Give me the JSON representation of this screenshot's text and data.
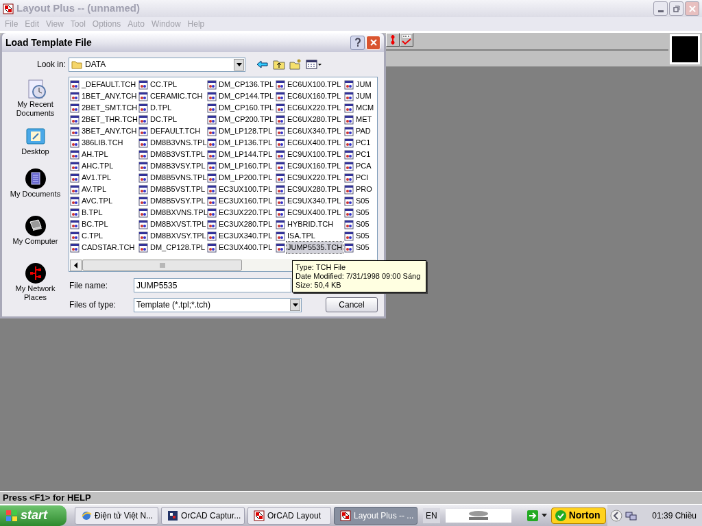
{
  "app": {
    "title": "Layout Plus -- (unnamed)",
    "active": false
  },
  "menu": [
    "File",
    "Edit",
    "View",
    "Tool",
    "Options",
    "Auto",
    "Window",
    "Help"
  ],
  "dialog": {
    "title": "Load Template File",
    "look_in_label": "Look in:",
    "look_in_value": "DATA",
    "places": [
      {
        "kind": "recent",
        "label": "My Recent Documents"
      },
      {
        "kind": "desktop",
        "label": "Desktop"
      },
      {
        "kind": "documents",
        "label": "My Documents"
      },
      {
        "kind": "computer",
        "label": "My Computer"
      },
      {
        "kind": "network",
        "label": "My Network Places"
      }
    ],
    "columns": [
      [
        {
          "name": "_DEFAULT.TCH",
          "selected": false
        },
        {
          "name": "1BET_ANY.TCH",
          "selected": false
        },
        {
          "name": "2BET_SMT.TCH",
          "selected": false
        },
        {
          "name": "2BET_THR.TCH",
          "selected": false
        },
        {
          "name": "3BET_ANY.TCH",
          "selected": false
        },
        {
          "name": "386LIB.TCH",
          "selected": false
        },
        {
          "name": "AH.TPL",
          "selected": false
        },
        {
          "name": "AHC.TPL",
          "selected": false
        },
        {
          "name": "AV1.TPL",
          "selected": false
        },
        {
          "name": "AV.TPL",
          "selected": false
        },
        {
          "name": "AVC.TPL",
          "selected": false
        },
        {
          "name": "B.TPL",
          "selected": false
        },
        {
          "name": "BC.TPL",
          "selected": false
        },
        {
          "name": "C.TPL",
          "selected": false
        },
        {
          "name": "CADSTAR.TCH",
          "selected": false
        }
      ],
      [
        {
          "name": "CC.TPL",
          "selected": false
        },
        {
          "name": "CERAMIC.TCH",
          "selected": false
        },
        {
          "name": "D.TPL",
          "selected": false
        },
        {
          "name": "DC.TPL",
          "selected": false
        },
        {
          "name": "DEFAULT.TCH",
          "selected": false
        },
        {
          "name": "DM8B3VNS.TPL",
          "selected": false
        },
        {
          "name": "DM8B3VST.TPL",
          "selected": false
        },
        {
          "name": "DM8B3VSY.TPL",
          "selected": false
        },
        {
          "name": "DM8B5VNS.TPL",
          "selected": false
        },
        {
          "name": "DM8B5VST.TPL",
          "selected": false
        },
        {
          "name": "DM8B5VSY.TPL",
          "selected": false
        },
        {
          "name": "DM8BXVNS.TPL",
          "selected": false
        },
        {
          "name": "DM8BXVST.TPL",
          "selected": false
        },
        {
          "name": "DM8BXVSY.TPL",
          "selected": false
        },
        {
          "name": "DM_CP128.TPL",
          "selected": false
        }
      ],
      [
        {
          "name": "DM_CP136.TPL",
          "selected": false
        },
        {
          "name": "DM_CP144.TPL",
          "selected": false
        },
        {
          "name": "DM_CP160.TPL",
          "selected": false
        },
        {
          "name": "DM_CP200.TPL",
          "selected": false
        },
        {
          "name": "DM_LP128.TPL",
          "selected": false
        },
        {
          "name": "DM_LP136.TPL",
          "selected": false
        },
        {
          "name": "DM_LP144.TPL",
          "selected": false
        },
        {
          "name": "DM_LP160.TPL",
          "selected": false
        },
        {
          "name": "DM_LP200.TPL",
          "selected": false
        },
        {
          "name": "EC3UX100.TPL",
          "selected": false
        },
        {
          "name": "EC3UX160.TPL",
          "selected": false
        },
        {
          "name": "EC3UX220.TPL",
          "selected": false
        },
        {
          "name": "EC3UX280.TPL",
          "selected": false
        },
        {
          "name": "EC3UX340.TPL",
          "selected": false
        },
        {
          "name": "EC3UX400.TPL",
          "selected": false
        }
      ],
      [
        {
          "name": "EC6UX100.TPL",
          "selected": false
        },
        {
          "name": "EC6UX160.TPL",
          "selected": false
        },
        {
          "name": "EC6UX220.TPL",
          "selected": false
        },
        {
          "name": "EC6UX280.TPL",
          "selected": false
        },
        {
          "name": "EC6UX340.TPL",
          "selected": false
        },
        {
          "name": "EC6UX400.TPL",
          "selected": false
        },
        {
          "name": "EC9UX100.TPL",
          "selected": false
        },
        {
          "name": "EC9UX160.TPL",
          "selected": false
        },
        {
          "name": "EC9UX220.TPL",
          "selected": false
        },
        {
          "name": "EC9UX280.TPL",
          "selected": false
        },
        {
          "name": "EC9UX340.TPL",
          "selected": false
        },
        {
          "name": "EC9UX400.TPL",
          "selected": false
        },
        {
          "name": "HYBRID.TCH",
          "selected": false
        },
        {
          "name": "ISA.TPL",
          "selected": false
        },
        {
          "name": "JUMP5535.TCH",
          "selected": true
        }
      ],
      [
        {
          "name": "JUM",
          "selected": false
        },
        {
          "name": "JUM",
          "selected": false
        },
        {
          "name": "MCM",
          "selected": false
        },
        {
          "name": "MET",
          "selected": false
        },
        {
          "name": "PAD",
          "selected": false
        },
        {
          "name": "PC1",
          "selected": false
        },
        {
          "name": "PC1",
          "selected": false
        },
        {
          "name": "PCA",
          "selected": false
        },
        {
          "name": "PCI",
          "selected": false
        },
        {
          "name": "PRO",
          "selected": false
        },
        {
          "name": "S05",
          "selected": false
        },
        {
          "name": "S05",
          "selected": false
        },
        {
          "name": "S05",
          "selected": false
        },
        {
          "name": "S05",
          "selected": false
        },
        {
          "name": "S05",
          "selected": false
        }
      ]
    ],
    "file_name_label": "File name:",
    "file_name_value": "JUMP5535",
    "file_type_label": "Files of type:",
    "file_type_value": "Template (*.tpl;*.tch)",
    "cancel": "Cancel",
    "tooltip": [
      "Type: TCH File",
      "Date Modified: 7/31/1998 09:00 Sáng",
      "Size: 50,4 KB"
    ]
  },
  "status_bar": "Press <F1> for HELP",
  "taskbar": {
    "start": "start",
    "tasks": [
      {
        "kind": "browser",
        "label": "Điện tử Việt N...",
        "selected": false
      },
      {
        "kind": "capture",
        "label": "OrCAD Captur...",
        "selected": false
      },
      {
        "kind": "layout",
        "label": "OrCAD Layout",
        "selected": false
      },
      {
        "kind": "layout",
        "label": "Layout Plus -- ...",
        "selected": true
      }
    ],
    "language": "EN",
    "antivirus": "Norton",
    "clock": "01:39 Chiều"
  }
}
